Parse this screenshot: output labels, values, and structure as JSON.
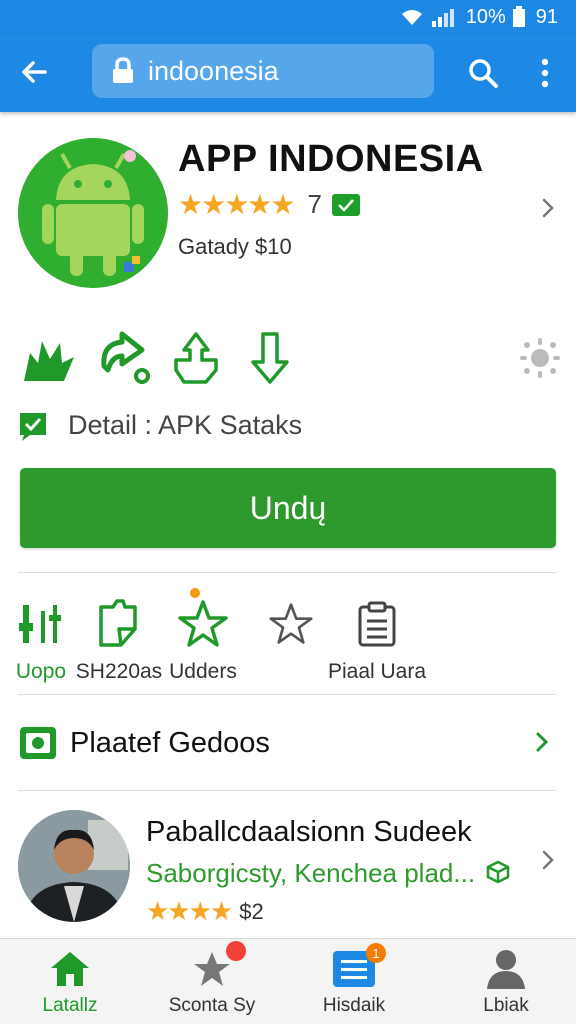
{
  "status_bar": {
    "battery_percent": "10%",
    "time": "91"
  },
  "app_bar": {
    "search_value": "indoonesia"
  },
  "app": {
    "title": "APP INDONESIA",
    "stars": "★★★★★",
    "rating_count": "7",
    "price": "Gatady $10"
  },
  "detail": {
    "label": "Detail : APK Sataks"
  },
  "download_button": {
    "label": "Undų"
  },
  "features": [
    {
      "label": "Uopo",
      "icon": "sliders-icon"
    },
    {
      "label": "SH220as",
      "icon": "clipboard-icon"
    },
    {
      "label": "Udders",
      "icon": "star-outline-green-icon"
    },
    {
      "label": "",
      "icon": "star-outline-icon"
    },
    {
      "label": "Piaal Uara",
      "icon": "document-icon"
    }
  ],
  "section": {
    "title": "Plaatef Gedoos"
  },
  "review": {
    "title": "Paballcdaalsionn Sudeek",
    "subtitle": "Saborgicsty, Kenchea plad...",
    "stars": "★★★★",
    "price": "$2"
  },
  "bottom_nav": [
    {
      "label": "Latallz",
      "icon": "home-icon",
      "badge": ""
    },
    {
      "label": "Sconta Sy",
      "icon": "star-icon",
      "badge": ""
    },
    {
      "label": "Hisdaik",
      "icon": "list-icon",
      "badge": "1"
    },
    {
      "label": "Lbiak",
      "icon": "person-icon",
      "badge": ""
    }
  ],
  "colors": {
    "primary_blue": "#1e88e5",
    "brand_green": "#2e9a2e",
    "star_yellow": "#f5a623",
    "badge_red": "#f44336"
  }
}
